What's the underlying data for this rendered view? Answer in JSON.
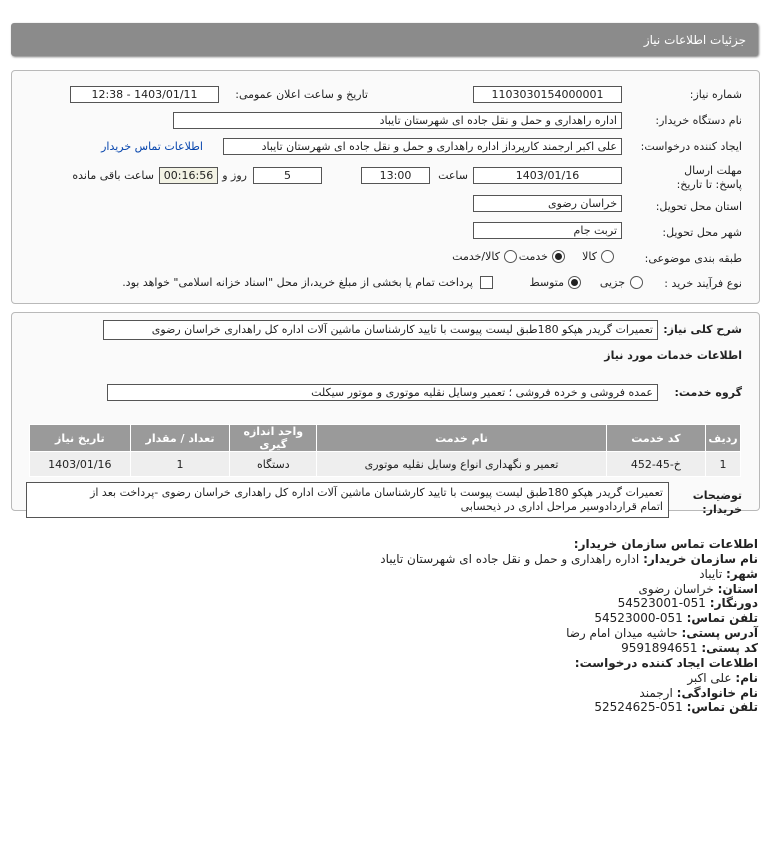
{
  "header": {
    "title": "جزئیات اطلاعات نیاز"
  },
  "form": {
    "need_number_label": "شماره نیاز:",
    "need_number": "1103030154000001",
    "announce_label": "تاریخ و ساعت اعلان عمومی:",
    "announce_value": "1403/01/11 - 12:38",
    "buyer_label": "نام دستگاه خریدار:",
    "buyer_value": "اداره راهداری و حمل و نقل جاده ای شهرستان تایباد",
    "creator_label": "ایجاد کننده درخواست:",
    "creator_value": "علی اکبر ارجمند کارپرداز اداره راهداری و حمل و نقل جاده ای شهرستان تایباد",
    "contact_link": "اطلاعات تماس خریدار",
    "deadline_label": "مهلت ارسال پاسخ: تا تاریخ:",
    "deadline_date": "1403/01/16",
    "time_label": "ساعت",
    "deadline_time": "13:00",
    "days_value": "5",
    "days_label": "روز و",
    "remaining_value": "00:16:56",
    "remaining_label": "ساعت باقی مانده",
    "province_label": "استان محل تحویل:",
    "province_value": "خراسان رضوی",
    "city_label": "شهر محل تحویل:",
    "city_value": "تربت جام",
    "category_label": "طبقه بندی موضوعی:",
    "category_options": [
      "کالا",
      "خدمت",
      "کالا/خدمت"
    ],
    "process_label": "نوع فرآیند خرید :",
    "process_options": [
      "جزیی",
      "متوسط"
    ],
    "payment_text": "پرداخت تمام یا بخشی از مبلغ خرید،از محل \"اسناد خزانه اسلامی\" خواهد بود."
  },
  "summary": {
    "label": "شرح کلی نیاز:",
    "value": "تعمیرات گریدر هپکو 180طبق لیست پیوست با تایید کارشناسان ماشین آلات اداره کل راهداری خراسان رضوی",
    "services_title": "اطلاعات خدمات مورد نیاز",
    "group_label": "گروه خدمت:",
    "group_value": "عمده فروشی و خرده فروشی ؛ تعمیر وسایل نقلیه موتوری و موتور سیکلت"
  },
  "table": {
    "headers": [
      "ردیف",
      "کد خدمت",
      "نام خدمت",
      "واحد اندازه گیری",
      "تعداد / مقدار",
      "تاریخ نیاز"
    ],
    "rows": [
      [
        "1",
        "خ-45-452",
        "تعمیر و نگهداری انواع وسایل نقلیه موتوری",
        "دستگاه",
        "1",
        "1403/01/16"
      ]
    ]
  },
  "notes": {
    "label": "توضیحات خریدار:",
    "line1": "تعمیرات گریدر هپکو 180طبق لیست پیوست با تایید کارشناسان ماشین آلات اداره کل راهداری خراسان رضوی -پرداخت بعد از",
    "line2": "اتمام قراردادوسیر مراحل اداری در ذیحسابی"
  },
  "contact": {
    "title": "اطلاعات تماس سازمان خریدار:",
    "org_label": "نام سازمان خریدار:",
    "org_value": "اداره راهداری و حمل و نقل جاده ای شهرستان تایباد",
    "city_label": "شهر:",
    "city_value": "تایباد",
    "province_label": "استان:",
    "province_value": "خراسان رضوی",
    "fax_label": "دورنگار:",
    "fax_value": "051-54523001",
    "phone_label": "تلفن تماس:",
    "phone_value": "051-54523000",
    "address_label": "آدرس پستی:",
    "address_value": "حاشیه میدان امام رضا",
    "postal_label": "کد پستی:",
    "postal_value": "9591894651",
    "creator_title": "اطلاعات ایجاد کننده درخواست:",
    "name_label": "نام:",
    "name_value": "علی اکبر",
    "family_label": "نام خانوادگی:",
    "family_value": "ارجمند",
    "creator_phone_label": "تلفن تماس:",
    "creator_phone_value": "051-52524625"
  }
}
